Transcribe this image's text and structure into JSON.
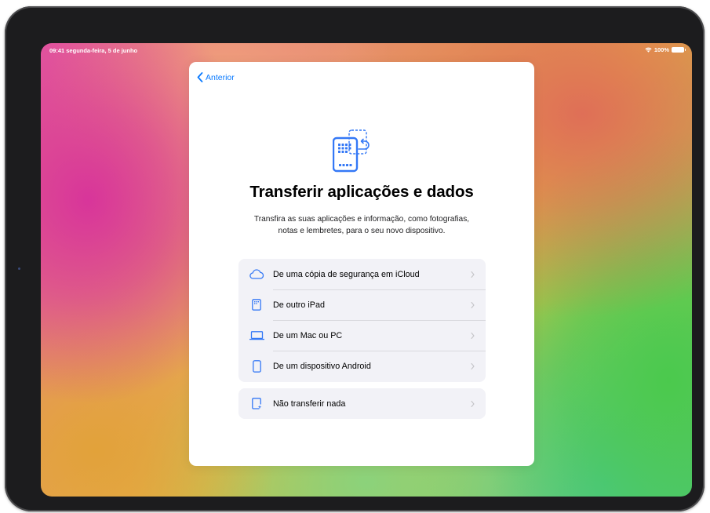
{
  "status_bar": {
    "time_date": "09:41  segunda-feira, 5 de junho",
    "battery": "100%"
  },
  "sheet": {
    "back_label": "Anterior",
    "title": "Transferir aplicações e dados",
    "subtitle_line1": "Transfira as suas aplicações e informação, como fotografias,",
    "subtitle_line2": "notas e lembretes, para o seu novo dispositivo.",
    "options": [
      {
        "label": "De uma cópia de segurança em iCloud",
        "icon": "cloud-icon"
      },
      {
        "label": "De outro iPad",
        "icon": "ipad-icon"
      },
      {
        "label": "De um Mac ou PC",
        "icon": "laptop-icon"
      },
      {
        "label": "De um dispositivo Android",
        "icon": "phone-icon"
      }
    ],
    "skip_option": {
      "label": "Não transferir nada",
      "icon": "sparkle-document-icon"
    }
  },
  "colors": {
    "accent": "#0a7aff",
    "icon_blue": "#3478f6",
    "row_background": "#f2f2f7",
    "chevron": "#c4c4c7"
  }
}
